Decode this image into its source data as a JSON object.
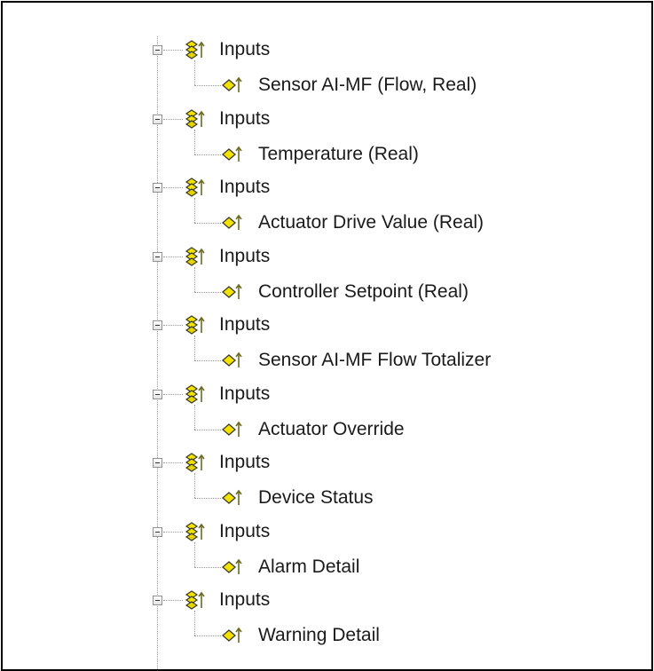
{
  "tree": {
    "groups": [
      {
        "label": "Inputs",
        "child": "Sensor AI-MF (Flow, Real)"
      },
      {
        "label": "Inputs",
        "child": "Temperature (Real)"
      },
      {
        "label": "Inputs",
        "child": "Actuator Drive Value (Real)"
      },
      {
        "label": "Inputs",
        "child": "Controller Setpoint (Real)"
      },
      {
        "label": "Inputs",
        "child": "Sensor AI-MF Flow Totalizer"
      },
      {
        "label": "Inputs",
        "child": "Actuator Override"
      },
      {
        "label": "Inputs",
        "child": "Device Status"
      },
      {
        "label": "Inputs",
        "child": "Alarm Detail"
      },
      {
        "label": "Inputs",
        "child": "Warning Detail"
      }
    ],
    "icons": {
      "group": "input-group-icon",
      "child": "input-variable-icon",
      "expander": "collapse-minus-icon"
    },
    "colors": {
      "icon_yellow": "#f2e200",
      "icon_dark": "#4a4a30",
      "arrow": "#6b6b22"
    }
  }
}
